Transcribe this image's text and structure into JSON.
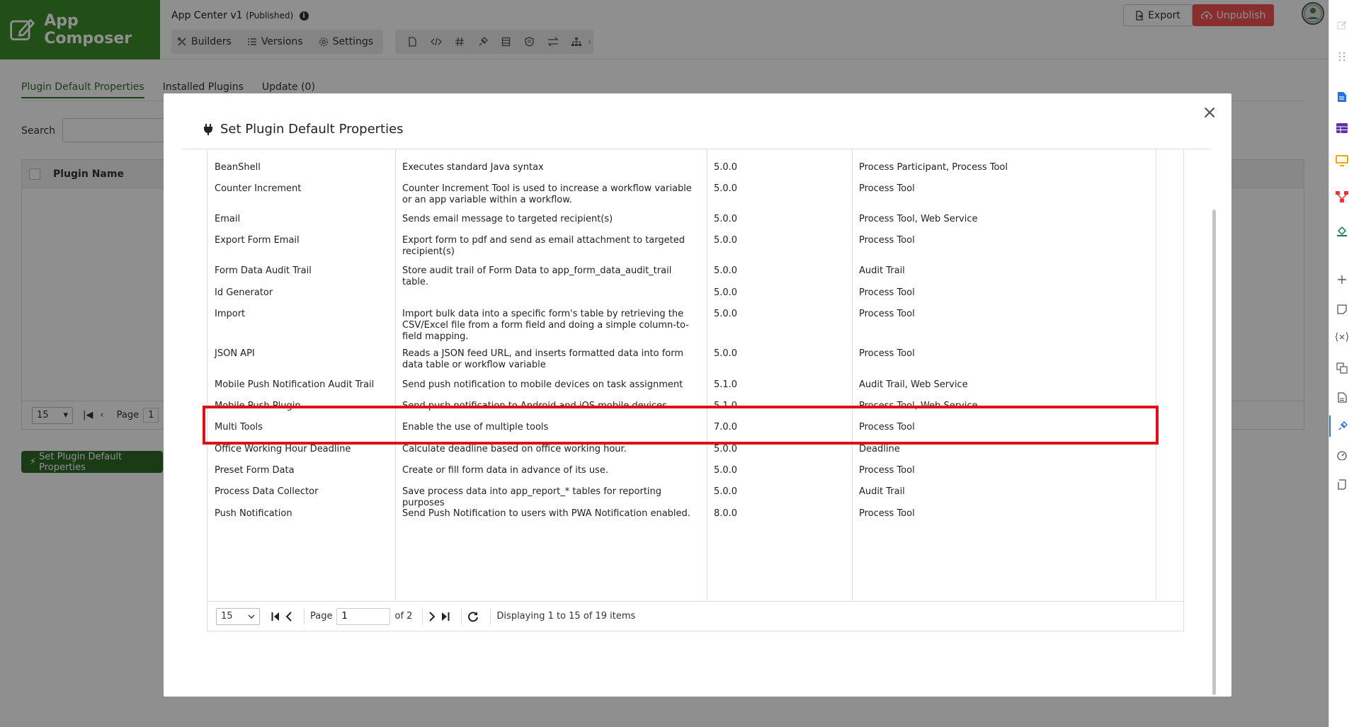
{
  "header": {
    "brand": "App Composer",
    "app_title": "App Center v1",
    "app_status": "(Published)",
    "info_glyph": "i",
    "nav": [
      {
        "label": "Builders",
        "icon": "builders-icon"
      },
      {
        "label": "Versions",
        "icon": "list-icon"
      },
      {
        "label": "Settings",
        "icon": "gear-icon"
      }
    ],
    "tools": [
      "file-icon",
      "code-icon",
      "hash-icon",
      "plugin-icon",
      "table-icon",
      "shield-icon",
      "swap-icon",
      "sitemap-icon"
    ],
    "more_glyph": "›",
    "export_label": "Export",
    "unpublish_label": "Unpublish"
  },
  "page": {
    "tabs": [
      "Plugin Default Properties",
      "Installed Plugins",
      "Update (0)"
    ],
    "search_label": "Search",
    "grid_header": "Plugin Name",
    "page_size": "15",
    "page_label": "Page",
    "page_value": "1",
    "set_button": "Set Plugin Default Properties"
  },
  "modal": {
    "title": "Set Plugin Default Properties",
    "close": "×",
    "rows": [
      {
        "name": "BeanShell",
        "description": "Executes standard Java syntax",
        "version": "5.0.0",
        "type": "Process Participant, Process Tool"
      },
      {
        "name": "Counter Increment",
        "description": "Counter Increment Tool is used to increase a workflow variable or an app variable within a workflow.",
        "version": "5.0.0",
        "type": "Process Tool"
      },
      {
        "name": "Email",
        "description": "Sends email message to targeted recipient(s)",
        "version": "5.0.0",
        "type": "Process Tool, Web Service"
      },
      {
        "name": "Export Form Email",
        "description": "Export form to pdf and send as email attachment to targeted recipient(s)",
        "version": "5.0.0",
        "type": "Process Tool"
      },
      {
        "name": "Form Data Audit Trail",
        "description": "Store audit trail of Form Data to app_form_data_audit_trail table.",
        "version": "5.0.0",
        "type": "Audit Trail"
      },
      {
        "name": "Id Generator",
        "description": "",
        "version": "5.0.0",
        "type": "Process Tool"
      },
      {
        "name": "Import",
        "description": "Import bulk data into a specific form's table by retrieving the CSV/Excel file from a form field and doing a simple column-to-field mapping.",
        "version": "5.0.0",
        "type": "Process Tool"
      },
      {
        "name": "JSON API",
        "description": "Reads a JSON feed URL, and inserts formatted data into form data table or workflow variable",
        "version": "5.0.0",
        "type": "Process Tool"
      },
      {
        "name": "Mobile Push Notification Audit Trail",
        "description": "Send push notification to mobile devices on task assignment",
        "version": "5.1.0",
        "type": "Audit Trail, Web Service"
      },
      {
        "name": "Mobile Push Plugin",
        "description": "Send push notification to Android and iOS mobile devices",
        "version": "5.1.0",
        "type": "Process Tool, Web Service"
      },
      {
        "name": "Multi Tools",
        "description": "Enable the use of multiple tools",
        "version": "7.0.0",
        "type": "Process Tool"
      },
      {
        "name": "Office Working Hour Deadline",
        "description": "Calculate deadline based on office working hour.",
        "version": "5.0.0",
        "type": "Deadline"
      },
      {
        "name": "Preset Form Data",
        "description": "Create or fill form data in advance of its use.",
        "version": "5.0.0",
        "type": "Process Tool"
      },
      {
        "name": "Process Data Collector",
        "description": "Save process data into app_report_* tables for reporting purposes",
        "version": "5.0.0",
        "type": "Audit Trail"
      },
      {
        "name": "Push Notification",
        "description": "Send Push Notification to users with PWA Notification enabled.",
        "version": "8.0.0",
        "type": "Process Tool"
      }
    ],
    "pager": {
      "page_size": "15",
      "page_label": "Page",
      "page_value": "1",
      "of_label": "of 2",
      "display_text": "Displaying 1 to 15 of 19 items"
    }
  },
  "colors": {
    "brand": "#3e8e2a",
    "unpublish": "#f25353",
    "highlight": "#e0101a"
  }
}
